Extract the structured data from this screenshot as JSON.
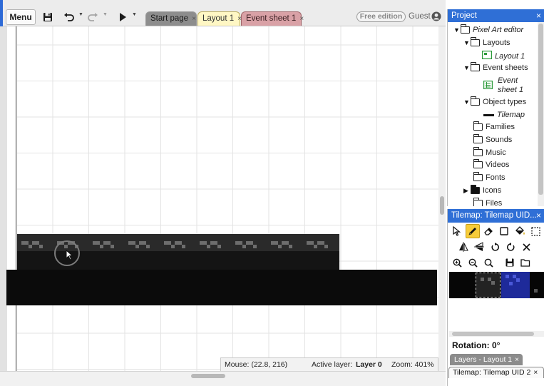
{
  "toolbar": {
    "menu_label": "Menu",
    "tabs": [
      {
        "label": "Start page",
        "close": "×"
      },
      {
        "label": "Layout 1",
        "close": "×"
      },
      {
        "label": "Event sheet 1",
        "close": "×"
      }
    ],
    "edition_badge": "Free edition",
    "user_label": "Guest",
    "icons": [
      "save-icon",
      "undo-icon",
      "redo-icon",
      "play-icon",
      "user-icon"
    ]
  },
  "status_bar": {
    "mouse": "Mouse: (22.8, 216)",
    "active_layer_label": "Active layer:",
    "active_layer_value": "Layer 0",
    "zoom": "Zoom: 401%"
  },
  "project_panel": {
    "title": "Project",
    "close": "×",
    "tree": [
      {
        "label": "Pixel Art editor",
        "italic": true
      },
      {
        "label": "Layouts"
      },
      {
        "label": "Layout 1",
        "italic": true
      },
      {
        "label": "Event sheets"
      },
      {
        "label_line1": "Event",
        "label_line2": "sheet 1",
        "italic": true
      },
      {
        "label": "Object types"
      },
      {
        "label": "Tilemap",
        "italic": true
      },
      {
        "label": "Families"
      },
      {
        "label": "Sounds"
      },
      {
        "label": "Music"
      },
      {
        "label": "Videos"
      },
      {
        "label": "Fonts"
      },
      {
        "label": "Icons"
      },
      {
        "label": "Files"
      }
    ]
  },
  "tilemap_panel": {
    "title": "Tilemap: Tilemap UID...",
    "close": "×",
    "tools": [
      "select-tool",
      "pencil-tool",
      "eraser-tool",
      "rectangle-tool",
      "fill-tool",
      "marquee-tool",
      "flip-horizontal-tool",
      "flip-vertical-tool",
      "rotate-ccw-tool",
      "rotate-cw-tool",
      "reset-tool",
      "zoom-in-tool",
      "zoom-out-tool",
      "zoom-reset-tool",
      "save-tool",
      "open-tool"
    ],
    "active_tool": "pencil-tool",
    "rotation": "Rotation: 0°"
  },
  "bottom_tabs": [
    {
      "label": "Layers - Layout 1",
      "close": "×"
    },
    {
      "label": "Tilemap: Tilemap UID 2",
      "close": "×"
    }
  ]
}
